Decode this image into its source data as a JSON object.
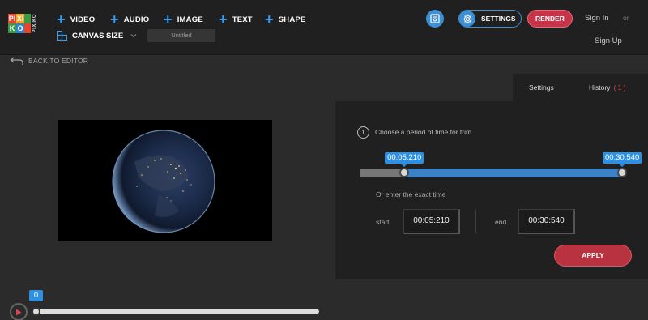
{
  "brand": {
    "logo_letters": [
      "PI",
      "XI",
      "KO"
    ],
    "logo_vertical": "PIXIKO"
  },
  "toolbar": {
    "add_items": [
      "VIDEO",
      "AUDIO",
      "IMAGE",
      "TEXT",
      "SHAPE"
    ],
    "canvas_size_label": "CANVAS SIZE",
    "project_name": "Untitled",
    "settings_label": "SETTINGS",
    "render_label": "RENDER",
    "signin_label": "Sign In",
    "or_label": "or",
    "signup_label": "Sign Up"
  },
  "nav": {
    "back_label": "BACK TO EDITOR"
  },
  "panel": {
    "tabs": [
      {
        "label": "Settings"
      },
      {
        "label": "History",
        "count": "( 1 )"
      }
    ],
    "step_number": "1",
    "step_text": "Choose a period of time for trim",
    "trim": {
      "start_label": "00:05:210",
      "end_label": "00:30:540",
      "start_fraction": 0.17,
      "end_fraction": 1.0
    },
    "exact_label": "Or enter the exact time",
    "start_field_label": "start",
    "start_value": "00:05:210",
    "end_field_label": "end",
    "end_value": "00:30:540",
    "apply_label": "APPLY"
  },
  "timeline": {
    "position_label": "0",
    "position_fraction": 0
  },
  "colors": {
    "accent_blue": "#3d8fd6",
    "render_red": "#c7344a",
    "apply_red": "#b8323f",
    "badge_red": "#e0404f"
  }
}
